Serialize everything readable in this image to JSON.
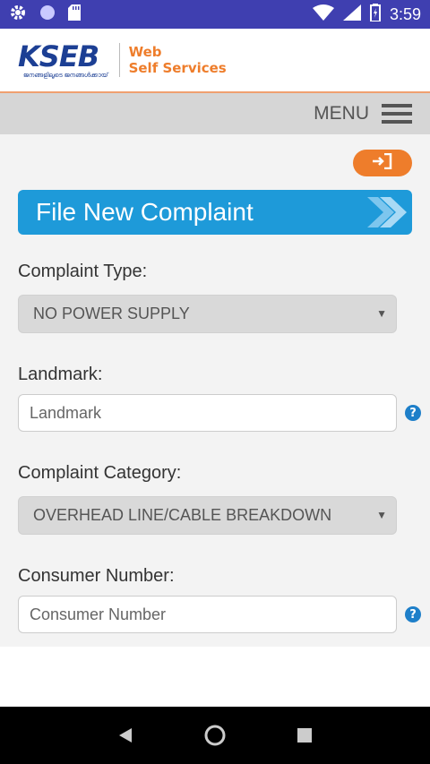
{
  "status_bar": {
    "time": "3:59",
    "left_icons": [
      "gear-icon",
      "circle-icon",
      "sd-card-icon"
    ],
    "right_icons": [
      "wifi-icon",
      "signal-icon",
      "battery-charging-icon"
    ]
  },
  "header": {
    "logo_text": "KSEB",
    "logo_subtext": "ജനങ്ങളിലൂടെ ജനങ്ങൾക്കായ്",
    "tagline_line1": "Web",
    "tagline_line2": "Self Services",
    "accent_color": "#ee7d2b",
    "brand_color": "#1c3f94"
  },
  "menu_bar": {
    "label": "MENU",
    "icon": "hamburger-icon"
  },
  "page": {
    "login_icon": "sign-in-icon",
    "title": "File New Complaint",
    "title_icon": "double-chevron-right-icon",
    "banner_color": "#1e9ad9"
  },
  "form": {
    "complaint_type": {
      "label": "Complaint Type:",
      "value": "NO POWER SUPPLY"
    },
    "landmark": {
      "label": "Landmark:",
      "placeholder": "Landmark",
      "value": ""
    },
    "complaint_category": {
      "label": "Complaint Category:",
      "value": "OVERHEAD LINE/CABLE BREAKDOWN"
    },
    "consumer_number": {
      "label": "Consumer Number:",
      "placeholder": "Consumer Number",
      "value": ""
    }
  },
  "nav_bar": {
    "buttons": [
      "back-icon",
      "home-icon",
      "recents-icon"
    ]
  }
}
